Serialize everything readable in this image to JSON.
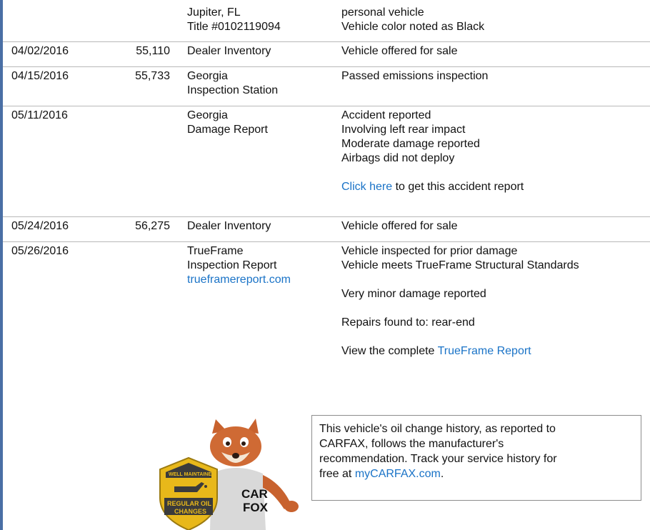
{
  "history": {
    "rows": [
      {
        "date": "",
        "odometer": "",
        "source": [
          "Jupiter, FL",
          "Title #0102119094"
        ],
        "comments": [
          "personal vehicle",
          "Vehicle color noted as Black"
        ]
      },
      {
        "date": "04/02/2016",
        "odometer": "55,110",
        "source": [
          "Dealer Inventory"
        ],
        "comments": [
          "Vehicle offered for sale"
        ]
      },
      {
        "date": "04/15/2016",
        "odometer": "55,733",
        "source": [
          "Georgia",
          "Inspection Station"
        ],
        "comments": [
          "Passed emissions inspection"
        ]
      },
      {
        "date": "05/11/2016",
        "odometer": "",
        "source": [
          "Georgia",
          "Damage Report"
        ],
        "comments": [
          "Accident reported",
          "Involving left rear impact",
          "Moderate damage reported",
          "Airbags did not deploy"
        ],
        "link_text": "Click here",
        "link_suffix": " to get this accident report"
      },
      {
        "date": "05/24/2016",
        "odometer": "56,275",
        "source": [
          "Dealer Inventory"
        ],
        "comments": [
          "Vehicle offered for sale"
        ]
      },
      {
        "date": "05/26/2016",
        "odometer": "",
        "source": [
          "TrueFrame",
          "Inspection Report"
        ],
        "source_link": "trueframereport.com",
        "comments": [
          "Vehicle inspected for prior damage",
          "Vehicle meets TrueFrame Structural Standards"
        ],
        "comment_minor": "Very minor damage reported",
        "comment_repairs": "Repairs found to: rear-end",
        "view_prefix": "View the complete ",
        "view_link": "TrueFrame Report"
      }
    ]
  },
  "oil_change": {
    "lines": [
      "This vehicle's oil change history, as reported to",
      "CARFAX, follows the manufacturer's",
      "recommendation. Track your service history for"
    ],
    "last_prefix": "free at ",
    "link": "myCARFAX.com",
    "last_suffix": "."
  },
  "badge": {
    "top_text": "WELL MAINTAINED",
    "line1": "REGULAR OIL",
    "line2": "CHANGES"
  },
  "shirt_logo": {
    "line1": "CAR",
    "line2": "FOX"
  },
  "colors": {
    "link": "#1a73c7",
    "left_border": "#4a6fa5",
    "badge_gold": "#e8b81a",
    "badge_dark": "#3b3b3b",
    "fox_orange": "#c8622e"
  }
}
